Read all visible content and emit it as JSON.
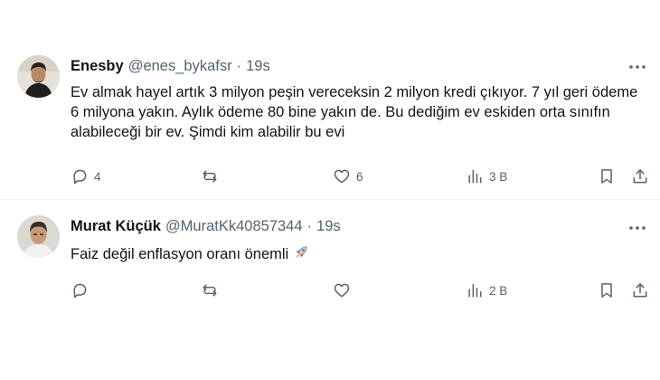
{
  "tweets": [
    {
      "author_name": "Enesby",
      "author_handle": "@enes_bykafsr",
      "separator": "·",
      "time": "19s",
      "text": "Ev almak hayel artık 3 milyon peşin vereceksin 2 milyon kredi çıkıyor. 7 yıl geri ödeme 6 milyona yakın. Aylık ödeme 80 bine yakın de. Bu dediğim ev eskiden orta sınıfın alabileceği bir ev. Şimdi kim alabilir bu evi",
      "emoji": "",
      "replies": "4",
      "retweets": "",
      "likes": "6",
      "views": "3 B"
    },
    {
      "author_name": "Murat Küçük",
      "author_handle": "@MuratKk40857344",
      "separator": "·",
      "time": "19s",
      "text": "Faiz değil enflasyon oranı önemli",
      "emoji": "🚀",
      "replies": "",
      "retweets": "",
      "likes": "",
      "views": "2 B"
    }
  ],
  "icons": {
    "more": "more-horizontal-icon",
    "reply": "reply-icon",
    "retweet": "retweet-icon",
    "like": "heart-icon",
    "views": "views-chart-icon",
    "bookmark": "bookmark-icon",
    "share": "share-icon"
  },
  "colors": {
    "text_primary": "#0f1419",
    "text_secondary": "#536471",
    "divider": "#eff3f4"
  }
}
